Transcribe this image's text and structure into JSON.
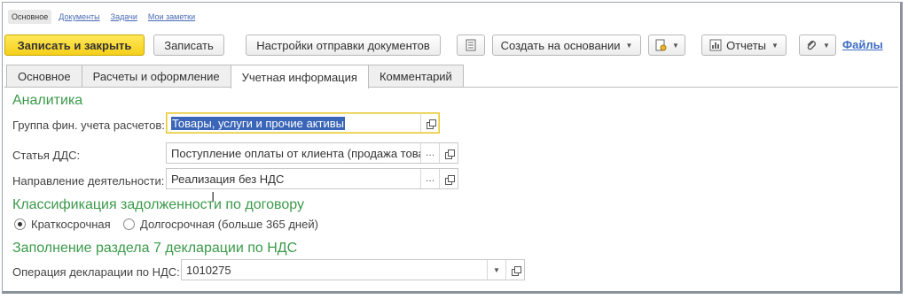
{
  "nav": {
    "main": "Основное",
    "documents": "Документы",
    "tasks": "Задачи",
    "notes": "Мои заметки"
  },
  "toolbar": {
    "save_close": "Записать и закрыть",
    "save": "Записать",
    "send_settings": "Настройки отправки документов",
    "create_based": "Создать на основании",
    "reports": "Отчеты",
    "files": "Файлы"
  },
  "tabs": [
    {
      "label": "Основное"
    },
    {
      "label": "Расчеты и оформление"
    },
    {
      "label": "Учетная информация"
    },
    {
      "label": "Комментарий"
    }
  ],
  "analytics": {
    "title": "Аналитика",
    "group_label": "Группа фин. учета расчетов:",
    "group_value": "Товары, услуги и прочие активы",
    "dds_label": "Статья ДДС:",
    "dds_value": "Поступление оплаты от клиента (продажа товар",
    "direction_label": "Направление деятельности:",
    "direction_value": "Реализация без НДС"
  },
  "classification": {
    "title": "Классификация задолженности по договору",
    "short_term": "Краткосрочная",
    "long_term": "Долгосрочная (больше 365 дней)"
  },
  "vat": {
    "title": "Заполнение раздела 7 декларации по НДС",
    "operation_label": "Операция декларации по НДС:",
    "operation_value": "1010275"
  },
  "icons": {
    "list": "list-icon",
    "print": "print-icon",
    "reports": "reports-icon",
    "attach": "paperclip-icon",
    "open": "open-icon",
    "more": "ellipsis-icon",
    "dropdown": "chevron-down-icon"
  },
  "colors": {
    "primary_button": "#f5cf1a",
    "section_title": "#3a9a4a",
    "selection": "#3a65b8",
    "link": "#3f6ec4"
  }
}
